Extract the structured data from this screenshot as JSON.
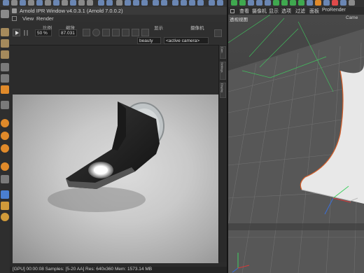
{
  "ipr": {
    "title": "Arnold IPR Window v4.0.3.1 (Arnold 7.0.0.2)",
    "menu": [
      "View",
      "Render"
    ],
    "headers": {
      "ratio": "比例",
      "zoom": "缩放",
      "display": "显示",
      "camera": "摄像机"
    },
    "fields": {
      "ratio": "50 %",
      "zoom": "87.031",
      "display": "beauty",
      "camera": "<active camera>"
    },
    "side_tabs": [
      "Cam",
      "Settings",
      "Display"
    ],
    "status": "[GPU] 00:00:08  Samples: [5-20 AA]  Res: 640x360  Mem: 1573.14 MB"
  },
  "viewport": {
    "menu": [
      "查看",
      "摄像机",
      "显示",
      "选项",
      "过滤",
      "面板",
      "ProRender"
    ],
    "label": "透视视图",
    "label_right": "Came"
  },
  "colors": {
    "accent_orange": "#e08a2a",
    "grid_line": "#555555",
    "selection_orange": "#d9602a",
    "axis_green": "#3fd060",
    "axis_blue": "#3a6fd8",
    "axis_red": "#d83a3a"
  }
}
